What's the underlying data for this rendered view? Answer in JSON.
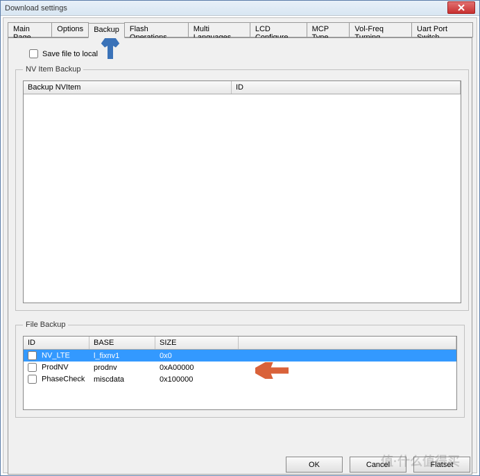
{
  "window": {
    "title": "Download settings"
  },
  "tabs": [
    "Main Page",
    "Options",
    "Backup",
    "Flash Operations",
    "Multi Languages",
    "LCD Configure",
    "MCP Type",
    "Vol-Freq Turning",
    "Uart Port Switch"
  ],
  "active_tab": 2,
  "save_file_label": "Save file to local",
  "nv_backup": {
    "legend": "NV Item Backup",
    "headers": {
      "name": "Backup NVItem",
      "id": "ID"
    }
  },
  "file_backup": {
    "legend": "File Backup",
    "headers": {
      "id": "ID",
      "base": "BASE",
      "size": "SIZE"
    },
    "rows": [
      {
        "id": "NV_LTE",
        "base": "l_fixnv1",
        "size": "0x0",
        "checked": false,
        "selected": true
      },
      {
        "id": "ProdNV",
        "base": "prodnv",
        "size": "0xA00000",
        "checked": false,
        "selected": false
      },
      {
        "id": "PhaseCheck",
        "base": "miscdata",
        "size": "0x100000",
        "checked": false,
        "selected": false
      }
    ]
  },
  "buttons": {
    "ok": "OK",
    "cancel": "Cancel",
    "flatset": "Flatset"
  }
}
